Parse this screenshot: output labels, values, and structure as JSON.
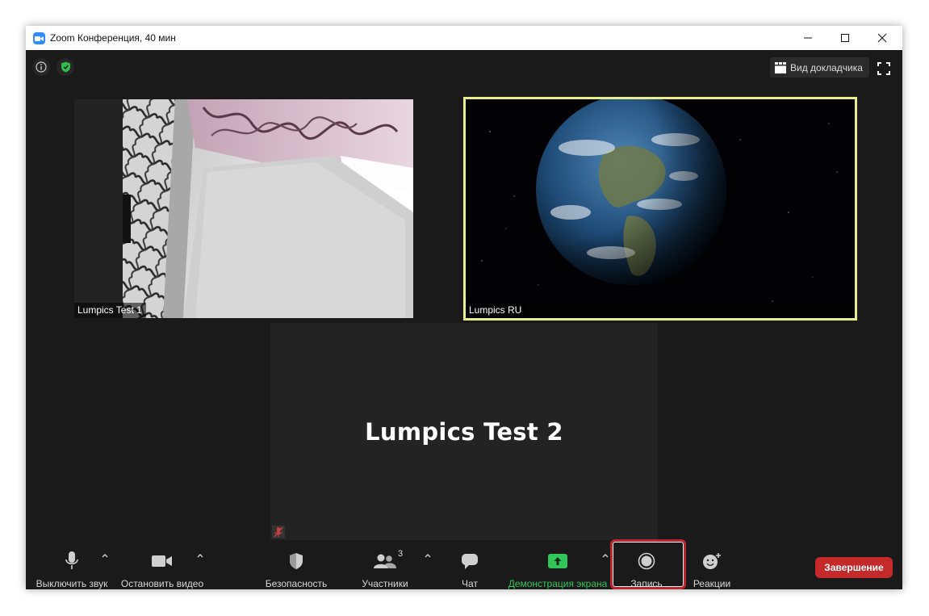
{
  "window": {
    "title": "Zoom Конференция, 40 мин"
  },
  "top_bar": {
    "speaker_view_label": "Вид докладчика"
  },
  "participants_tiles": [
    {
      "name": "Lumpics Test 1"
    },
    {
      "name": "Lumpics RU"
    },
    {
      "name": "Lumpics Test 2"
    }
  ],
  "toolbar": {
    "mute_label": "Выключить звук",
    "video_label": "Остановить видео",
    "security_label": "Безопасность",
    "participants_label": "Участники",
    "participants_count": "3",
    "chat_label": "Чат",
    "share_label": "Демонстрация экрана",
    "record_label": "Запись",
    "reactions_label": "Реакции",
    "end_label": "Завершение"
  },
  "colors": {
    "accent_green": "#31c55a",
    "end_red": "#c42a2a",
    "active_speaker_border": "#e8ee8e",
    "highlight_red": "#c0242c"
  }
}
